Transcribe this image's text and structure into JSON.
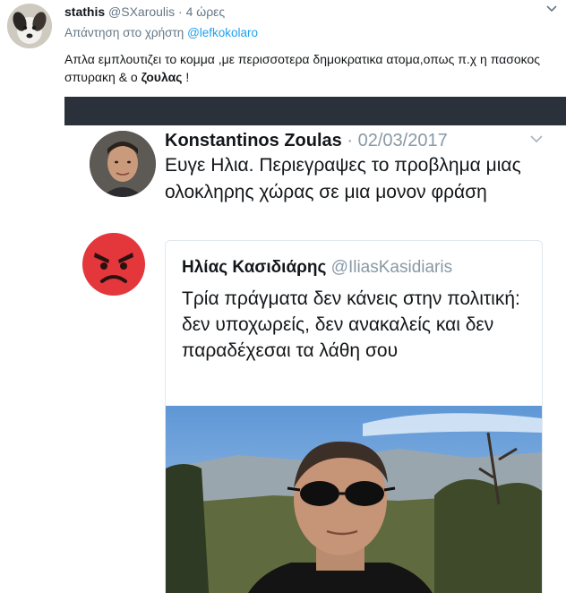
{
  "tweet": {
    "author_name": "stathis",
    "author_handle": "@SXaroulis",
    "separator": "·",
    "time": "4 ώρες",
    "reply_prefix": "Απάντηση στο χρήστη",
    "reply_to": "@lefkokolaro",
    "text_main": "Απλα εμπλουτιζει το κομμα ,με περισσοτερα δημοκρατικα ατομα,οπως π.χ η πασοκος σπυρακη & ο",
    "text_bold": "ζουλας",
    "text_end": " !",
    "icons": {
      "avatar": "dog-avatar",
      "menu": "chevron-down-icon"
    }
  },
  "screenshot": {
    "author_name": "Konstantinos Zoulas",
    "separator": "·",
    "date": "02/03/2017",
    "text": "Ευγε Ηλια. Περιεγραψες το προβλημα μιας ολοκληρης χώρας σε μια μονον φράση",
    "reaction_icon": "angry-face-emoji",
    "quoted": {
      "author_name": "Ηλίας Κασιδιάρης",
      "author_handle": "@IliasKasidiaris",
      "text": "Τρία πράγματα δεν κάνεις στην πολιτική: δεν υποχωρείς, δεν ανακαλείς και δεν παραδέχεσαι τα λάθη σου",
      "photo": "man-in-sunglasses-photo"
    }
  },
  "colors": {
    "link": "#1da1f2",
    "muted": "#657786",
    "text": "#14171a",
    "topbar": "#2b313a",
    "angry": "#e3373c"
  }
}
